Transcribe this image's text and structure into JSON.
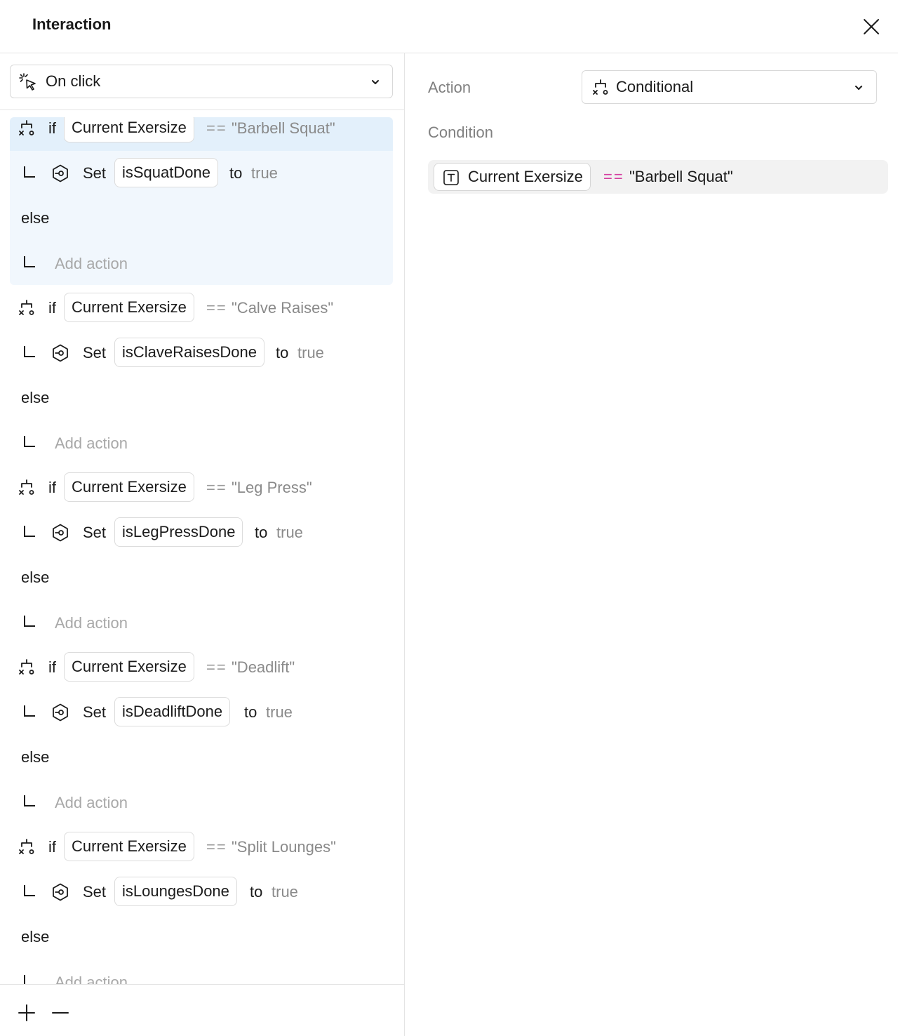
{
  "dialog": {
    "title": "Interaction"
  },
  "trigger": {
    "label": "On click"
  },
  "blocks": [
    {
      "if_kw": "if",
      "variable": "Current Exersize",
      "op": "==",
      "value": "\"Barbell Squat\"",
      "set_kw": "Set",
      "target": "isSquatDone",
      "to_kw": "to",
      "set_value": "true",
      "else_kw": "else",
      "add_action": "Add action"
    },
    {
      "if_kw": "if",
      "variable": "Current Exersize",
      "op": "==",
      "value": "\"Calve Raises\"",
      "set_kw": "Set",
      "target": "isClaveRaisesDone",
      "to_kw": "to",
      "set_value": "true",
      "else_kw": "else",
      "add_action": "Add action"
    },
    {
      "if_kw": "if",
      "variable": "Current Exersize",
      "op": "==",
      "value": "\"Leg Press\"",
      "set_kw": "Set",
      "target": "isLegPressDone",
      "to_kw": "to",
      "set_value": "true",
      "else_kw": "else",
      "add_action": "Add action"
    },
    {
      "if_kw": "if",
      "variable": "Current Exersize",
      "op": "==",
      "value": "\"Deadlift\"",
      "set_kw": "Set",
      "target": "isDeadliftDone",
      "to_kw": "to",
      "set_value": "true",
      "else_kw": "else",
      "add_action": "Add action"
    },
    {
      "if_kw": "if",
      "variable": "Current Exersize",
      "op": "==",
      "value": "\"Split Lounges\"",
      "set_kw": "Set",
      "target": "isLoungesDone",
      "to_kw": "to",
      "set_value": "true",
      "else_kw": "else",
      "add_action": "Add action"
    }
  ],
  "selected_block": 0,
  "detail": {
    "action_label": "Action",
    "action_value": "Conditional",
    "condition_label": "Condition",
    "condition_variable": "Current Exersize",
    "condition_op": "==",
    "condition_value": "\"Barbell Squat\""
  },
  "colors": {
    "selected_bg": "#f1f7fd",
    "operator_accent": "#d43fa0"
  }
}
